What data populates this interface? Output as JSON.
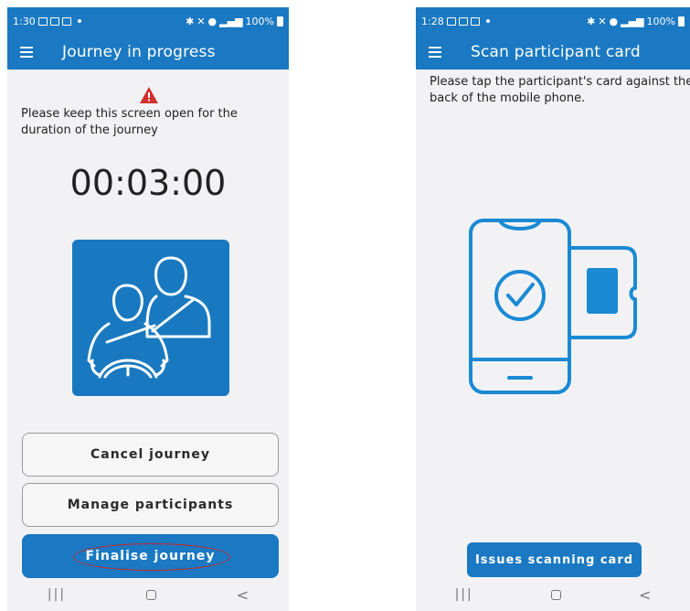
{
  "left_screen": {
    "status": {
      "time": "1:30",
      "battery": "100%"
    },
    "title": "Journey in progress",
    "message": "Please keep this screen open for the duration of the journey",
    "timer": "00:03:00",
    "buttons": {
      "cancel": "Cancel journey",
      "manage": "Manage participants",
      "finalise": "Finalise journey"
    },
    "icons": [
      "menu-icon",
      "warning-icon",
      "driver-passenger-seatbelt-icon"
    ]
  },
  "right_screen": {
    "status": {
      "time": "1:28",
      "battery": "100%"
    },
    "title": "Scan participant card",
    "message": "Please tap the participant's card against the back of the mobile phone.",
    "buttons": {
      "issues": "Issues scanning card"
    },
    "icons": [
      "menu-icon",
      "phone-card-tap-icon"
    ]
  },
  "colors": {
    "primary": "#1a79c2",
    "background": "#f2f2f4",
    "warning": "#d0312d",
    "annotation": "#c8242a"
  }
}
